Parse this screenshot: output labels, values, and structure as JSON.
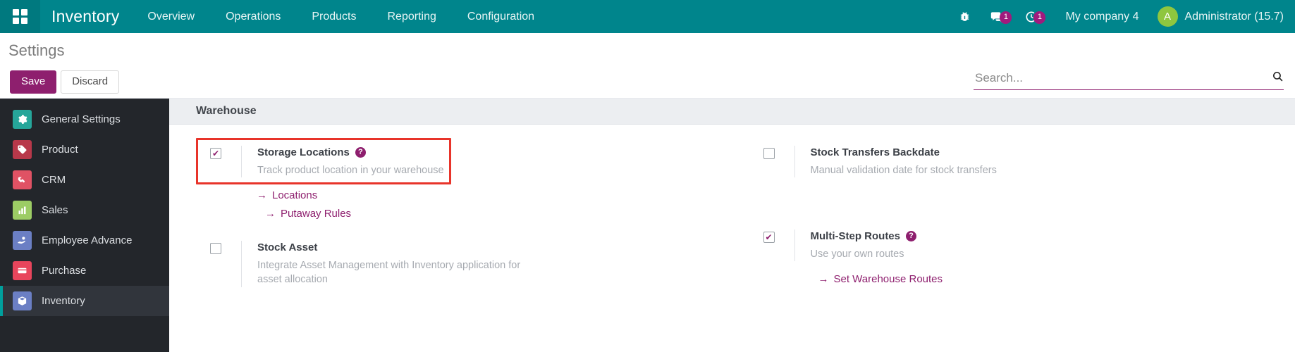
{
  "navbar": {
    "apps_icon": "grid-apps-icon",
    "brand": "Inventory",
    "menus": [
      "Overview",
      "Operations",
      "Products",
      "Reporting",
      "Configuration"
    ],
    "debug_icon": "bug-icon",
    "messages_icon": "chat-bubble-icon",
    "messages_count": "1",
    "activity_icon": "clock-activity-icon",
    "activity_count": "1",
    "company": "My company 4",
    "avatar_initial": "A",
    "user": "Administrator (15.7)",
    "bg_color": "#00858c",
    "badge_color": "#a01a7d",
    "avatar_color": "#8fc63f"
  },
  "control_panel": {
    "title": "Settings",
    "save_label": "Save",
    "discard_label": "Discard",
    "save_color": "#8e1f6e"
  },
  "search": {
    "value": "",
    "placeholder": "Search...",
    "icon": "magnifier-icon"
  },
  "sidebar": {
    "items": [
      {
        "label": "General Settings",
        "icon": "gear-icon",
        "glyph": "⚙",
        "color": "#26a69a",
        "active": false
      },
      {
        "label": "Product",
        "icon": "tag-icon",
        "glyph": "🏷",
        "color": "#b8384a",
        "active": false
      },
      {
        "label": "CRM",
        "icon": "handshake-icon",
        "glyph": "✋",
        "color": "#e05264",
        "active": false
      },
      {
        "label": "Sales",
        "icon": "bar-chart-icon",
        "glyph": "📊",
        "color": "#9ccc65",
        "active": false
      },
      {
        "label": "Employee Advance",
        "icon": "hand-money-icon",
        "glyph": "💵",
        "color": "#6b7fc4",
        "active": false
      },
      {
        "label": "Purchase",
        "icon": "credit-card-icon",
        "glyph": "💳",
        "color": "#e8455c",
        "active": false
      },
      {
        "label": "Inventory",
        "icon": "box-icon",
        "glyph": "📦",
        "color": "#6b7fc4",
        "active": true
      }
    ]
  },
  "settings": {
    "section_title": "Warehouse",
    "left_column": [
      {
        "name": "storage-locations",
        "title": "Storage Locations",
        "description": "Track product location in your warehouse",
        "checked": true,
        "has_help": true,
        "highlighted": true,
        "links": [
          {
            "label": "Locations"
          },
          {
            "label": "Putaway Rules"
          }
        ]
      },
      {
        "name": "stock-asset",
        "title": "Stock Asset",
        "description": "Integrate Asset Management with Inventory application for asset allocation",
        "checked": false,
        "has_help": false,
        "highlighted": false,
        "links": []
      }
    ],
    "right_column": [
      {
        "name": "stock-transfers-backdate",
        "title": "Stock Transfers Backdate",
        "description": "Manual validation date for stock transfers",
        "checked": false,
        "has_help": false,
        "highlighted": false,
        "links": []
      },
      {
        "name": "multi-step-routes",
        "title": "Multi-Step Routes",
        "description": "Use your own routes",
        "checked": true,
        "has_help": true,
        "highlighted": false,
        "links": [
          {
            "label": "Set Warehouse Routes"
          }
        ]
      }
    ],
    "checkmark_glyph": "✔",
    "link_arrow": "→",
    "help_glyph": "?",
    "highlight_color": "#e8342a"
  }
}
